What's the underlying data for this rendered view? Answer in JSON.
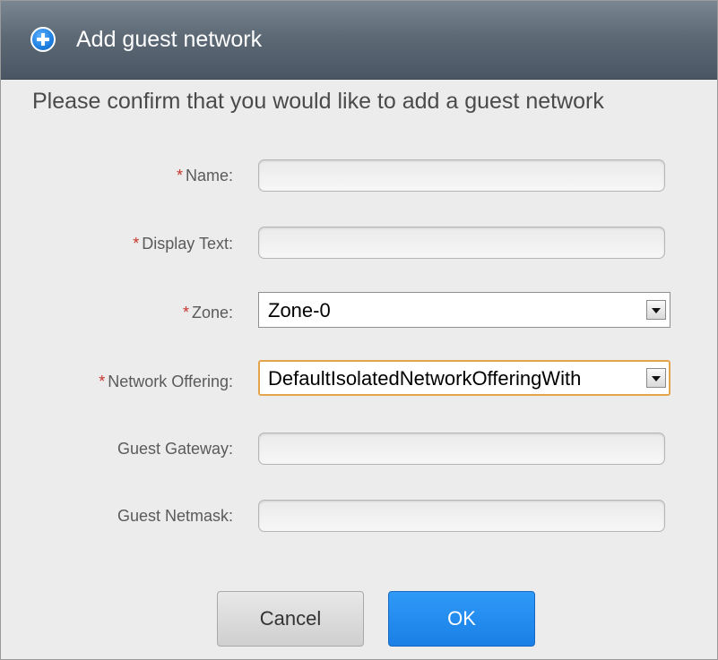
{
  "dialog": {
    "title": "Add guest network",
    "confirm_text": "Please confirm that you would like to add a guest network"
  },
  "form": {
    "name": {
      "label": "Name:",
      "required_mark": "*",
      "value": ""
    },
    "display_text": {
      "label": "Display Text:",
      "required_mark": "*",
      "value": ""
    },
    "zone": {
      "label": "Zone:",
      "required_mark": "*",
      "value": "Zone-0"
    },
    "network_offering": {
      "label": "Network Offering:",
      "required_mark": "*",
      "value": "DefaultIsolatedNetworkOfferingWith"
    },
    "guest_gateway": {
      "label": "Guest Gateway:",
      "value": ""
    },
    "guest_netmask": {
      "label": "Guest Netmask:",
      "value": ""
    }
  },
  "buttons": {
    "cancel_label": "Cancel",
    "ok_label": "OK"
  },
  "colors": {
    "required": "#c8352e",
    "ok_button": "#1a7fe6",
    "focus_border": "#e3a44b",
    "titlebar": "#5d6a76"
  },
  "icons": {
    "title": "add-circle-icon",
    "dropdown": "chevron-down-icon"
  }
}
